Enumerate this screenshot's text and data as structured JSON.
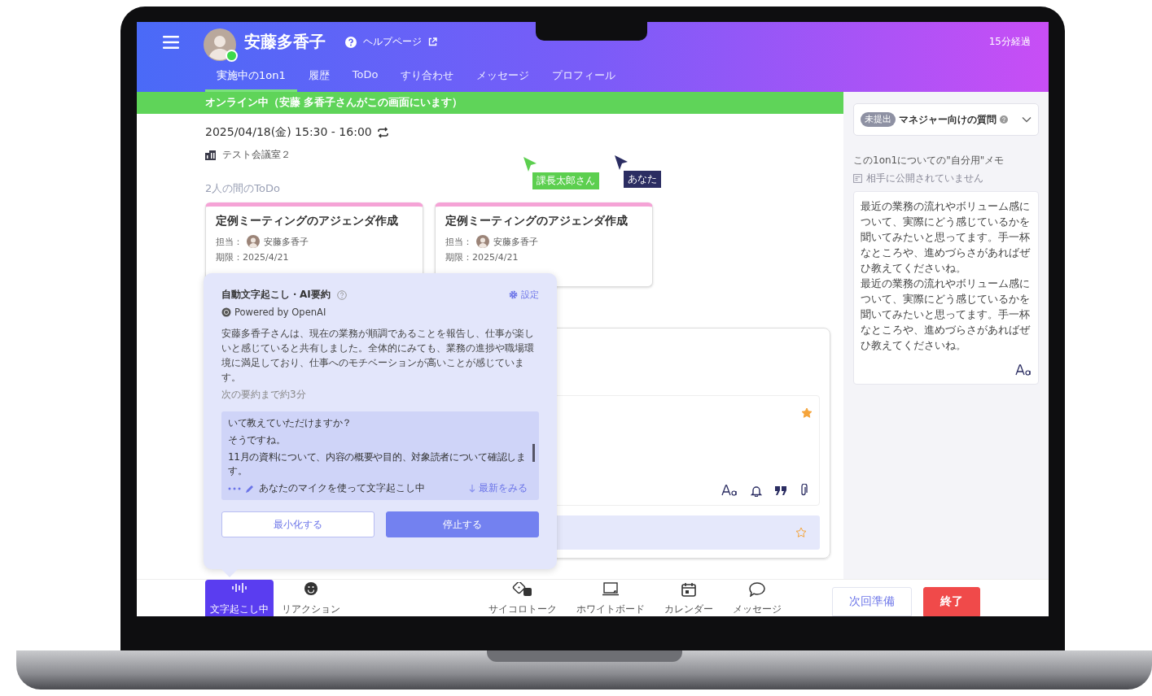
{
  "header": {
    "user_name": "安藤多香子",
    "online": true,
    "help_link": "ヘルプページ",
    "elapsed": "15分経過"
  },
  "tabs": [
    {
      "label": "実施中の1on1",
      "selected": true
    },
    {
      "label": "履歴",
      "selected": false
    },
    {
      "label": "ToDo",
      "selected": false
    },
    {
      "label": "すり合わせ",
      "selected": false
    },
    {
      "label": "メッセージ",
      "selected": false
    },
    {
      "label": "プロフィール",
      "selected": false
    }
  ],
  "presence_banner": "オンライン中（安藤 多香子さんがこの画面にいます）",
  "meeting": {
    "datetime": "2025/04/18(金) 15:30 - 16:00",
    "room": "テスト会議室２"
  },
  "cursors": [
    {
      "label": "課長太郎さん",
      "color": "#5ccf4f"
    },
    {
      "label": "あなた",
      "color": "#2b2d62"
    }
  ],
  "todo_section": {
    "title": "2人の間のToDo",
    "cards": [
      {
        "title": "定例ミーティングのアジェンダ作成",
        "assignee_label": "担当：",
        "assignee": "安藤多香子",
        "due": "期限：2025/4/21"
      },
      {
        "title": "定例ミーティングのアジェンダ作成",
        "assignee_label": "担当：",
        "assignee": "安藤多香子",
        "due": "期限：2025/4/21"
      }
    ]
  },
  "note_rows": [
    {
      "kind": "editor",
      "starred": true
    },
    {
      "kind": "entry",
      "starred": false
    }
  ],
  "ai_panel": {
    "title": "自動文字起こし・AI要約",
    "powered_by": "Powered by OpenAI",
    "settings": "設定",
    "summary": "安藤多香子さんは、現在の業務が順調であることを報告し、仕事が楽しいと感じていると共有しました。全体的にみても、業務の進捗や職場環境に満足しており、仕事へのモチベーションが高いことが感じています。",
    "next_summary": "次の要約まで約3分",
    "transcript": [
      "いて教えていただけますか？",
      "そうですね。",
      "11月の資料について、内容の概要や目的、対象読者について確認します。"
    ],
    "status": "あなたのマイクを使って文字起こし中",
    "latest_link": "最新をみる",
    "buttons": [
      {
        "label": "最小化する",
        "kind": "secondary"
      },
      {
        "label": "停止する",
        "kind": "primary"
      }
    ]
  },
  "sidebar": {
    "question": {
      "badge": "未提出",
      "title": "マネジャー向けの質問"
    },
    "memo_title": "この1on1についての\"自分用\"メモ",
    "visibility": "相手に公開されていません",
    "memo": [
      "最近の業務の流れやボリューム感について、実際にどう感じているかを聞いてみたいと思ってます。手一杯なところや、進めづらさがあればぜひ教えてくださいね。",
      "最近の業務の流れやボリューム感について、実際にどう感じているかを聞いてみたいと思ってます。手一杯なところや、進めづらさがあればぜひ教えてくださいね。"
    ]
  },
  "toolbar": {
    "left": [
      {
        "label": "文字起こし中",
        "selected": true
      },
      {
        "label": "リアクション",
        "selected": false
      }
    ],
    "center": [
      {
        "label": "サイコロトーク"
      },
      {
        "label": "ホワイトボード"
      },
      {
        "label": "カレンダー"
      },
      {
        "label": "メッセージ"
      }
    ],
    "actions": [
      {
        "label": "次回準備",
        "kind": "secondary"
      },
      {
        "label": "終了",
        "kind": "danger"
      }
    ]
  }
}
